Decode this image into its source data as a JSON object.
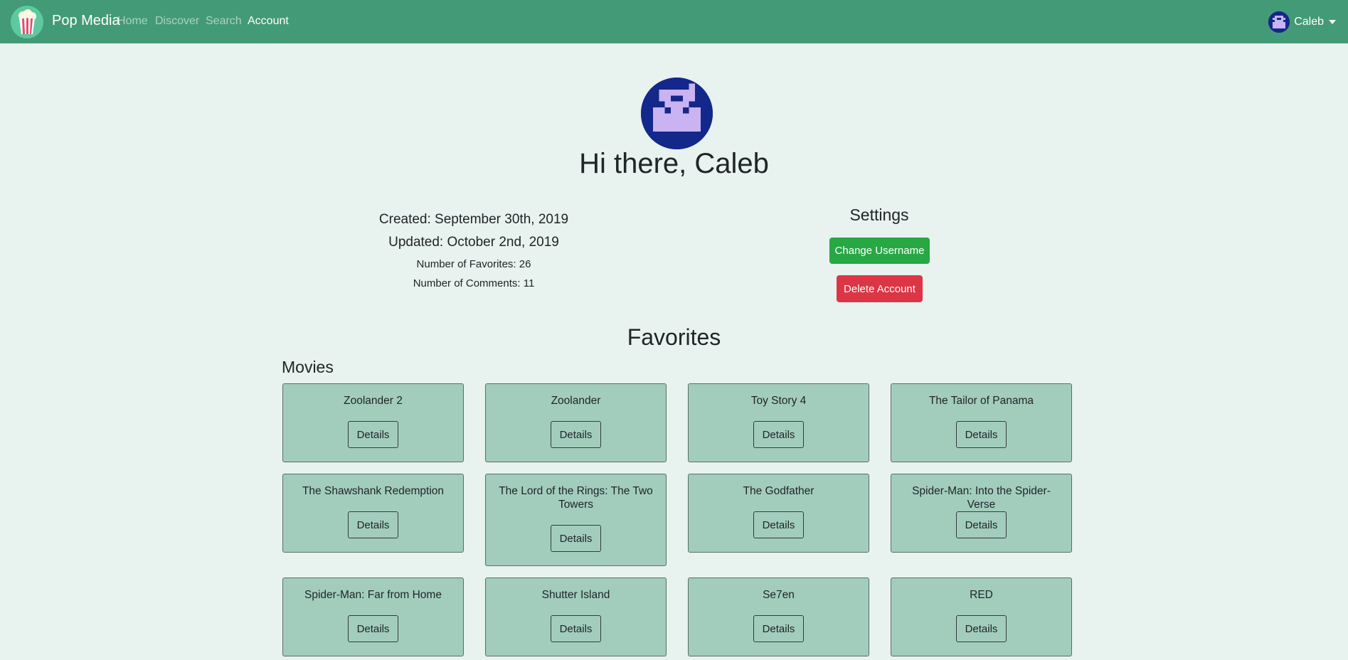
{
  "navbar": {
    "brand": "Pop Media",
    "links": [
      "Home",
      "Discover",
      "Search",
      "Account"
    ],
    "user": "Caleb"
  },
  "profile": {
    "greeting": "Hi there, Caleb",
    "created": "Created: September 30th, 2019",
    "updated": "Updated: October 2nd, 2019",
    "favorites_count": "Number of Favorites: 26",
    "comments_count": "Number of Comments: 11"
  },
  "settings": {
    "title": "Settings",
    "change_username": "Change Username",
    "delete_account": "Delete Account"
  },
  "favorites": {
    "title": "Favorites",
    "movies_title": "Movies",
    "details_label": "Details",
    "movies": [
      "Zoolander 2",
      "Zoolander",
      "Toy Story 4",
      "The Tailor of Panama",
      "The Shawshank Redemption",
      "The Lord of the Rings: The Two Towers",
      "The Godfather",
      "Spider-Man: Into the Spider-Verse",
      "Spider-Man: Far from Home",
      "Shutter Island",
      "Se7en",
      "RED"
    ]
  },
  "colors": {
    "navbar": "#439a77",
    "background": "#e8f2ee",
    "card": "#a2cdbd",
    "success": "#28a745",
    "danger": "#dc3545",
    "avatar_bg": "#14278a",
    "avatar_fg": "#c9b3f2"
  },
  "icons": {
    "brand": "popcorn-icon",
    "avatar": "pixel-avatar-icon",
    "caret": "caret-down-icon"
  }
}
